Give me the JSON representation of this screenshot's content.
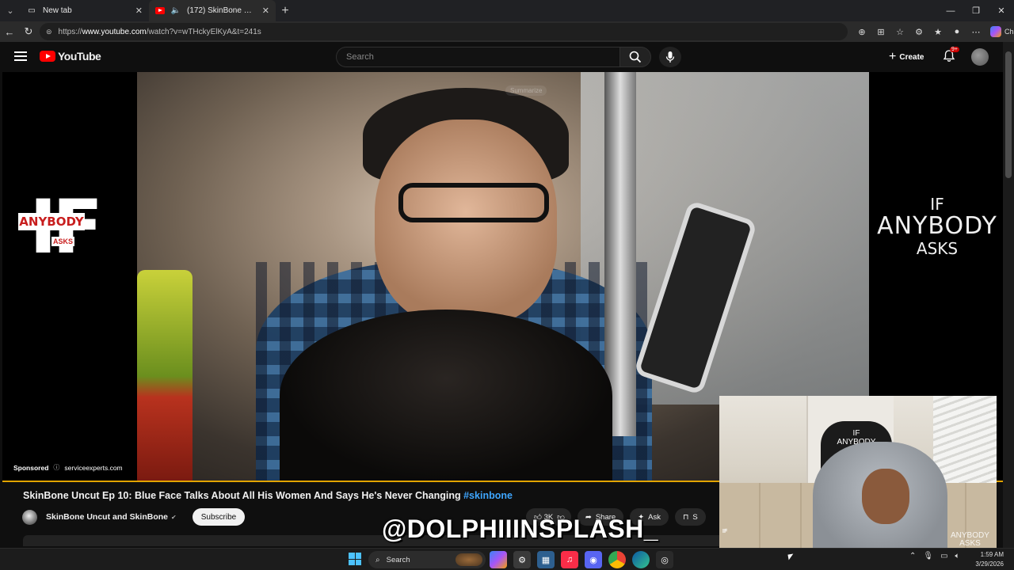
{
  "browser": {
    "tabs": [
      {
        "title": "New tab"
      },
      {
        "title": "(172) SkinBone Uncut Ep 10: B"
      }
    ],
    "url_prefix": "https://",
    "url_host": "www.youtube.com",
    "url_path": "/watch?v=wTHckyElKyA&t=241s",
    "chat_label": "Chat"
  },
  "youtube": {
    "logo_text": "YouTube",
    "search_placeholder": "Search",
    "create_label": "Create",
    "notif_badge": "9+"
  },
  "player": {
    "summarize_label": "Summarize",
    "sponsored_label": "Sponsored",
    "sponsor_domain": "serviceexperts.com",
    "brand_left": {
      "if": "IF",
      "anybody": "ANYBODY",
      "asks": "ASKS"
    },
    "brand_right": {
      "if": "IF",
      "anybody": "ANYBODY",
      "asks": "ASKS"
    },
    "progress_color": "#e2a400"
  },
  "video": {
    "title": "SkinBone Uncut Ep 10: Blue Face Talks About All His Women And Says He's Never Changing",
    "hashtag": "#skinbone",
    "channel": "SkinBone Uncut and SkinBone",
    "subscribe_label": "Subscribe",
    "likes": "3K",
    "share_label": "Share",
    "ask_label": "Ask",
    "save_label": "S"
  },
  "overlay": {
    "watermark": "@DOLPHIIINSPLASH_",
    "webcam_chair_text_1": "IF",
    "webcam_chair_text_2": "ANYBODY",
    "webcam_chair_text_3": "ASKS",
    "webcam_wm_1": "ANYBODY",
    "webcam_wm_2": "ASKS"
  },
  "taskbar": {
    "search_label": "Search",
    "time": "1:59 AM",
    "date": "3/29/2026"
  },
  "colors": {
    "youtube_red": "#ff0000",
    "hashtag_blue": "#3ea6ff"
  }
}
